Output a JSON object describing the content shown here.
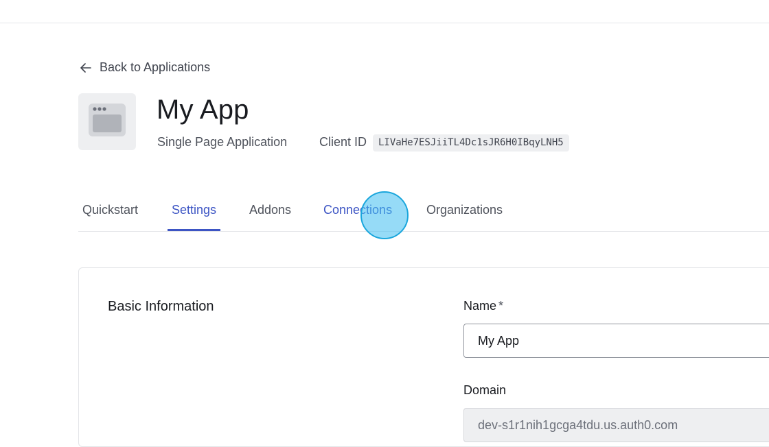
{
  "back_link": {
    "label": "Back to Applications",
    "icon": "arrow-left-icon"
  },
  "app": {
    "icon": "browser-window-icon",
    "name": "My App",
    "type": "Single Page Application",
    "client_id_label": "Client ID",
    "client_id": "LIVaHe7ESJiiTL4Dc1sJR6H0IBqyLNH5"
  },
  "tabs": [
    {
      "label": "Quickstart",
      "state": "default"
    },
    {
      "label": "Settings",
      "state": "active"
    },
    {
      "label": "Addons",
      "state": "default"
    },
    {
      "label": "Connections",
      "state": "hover"
    },
    {
      "label": "Organizations",
      "state": "default"
    }
  ],
  "basic_info": {
    "section_title": "Basic Information",
    "name_label": "Name",
    "required_marker": "*",
    "name_value": "My App",
    "domain_label": "Domain",
    "domain_value": "dev-s1r1nih1gcga4tdu.us.auth0.com"
  },
  "colors": {
    "accent": "#3d55c4",
    "click_indicator": "#40bef0"
  }
}
